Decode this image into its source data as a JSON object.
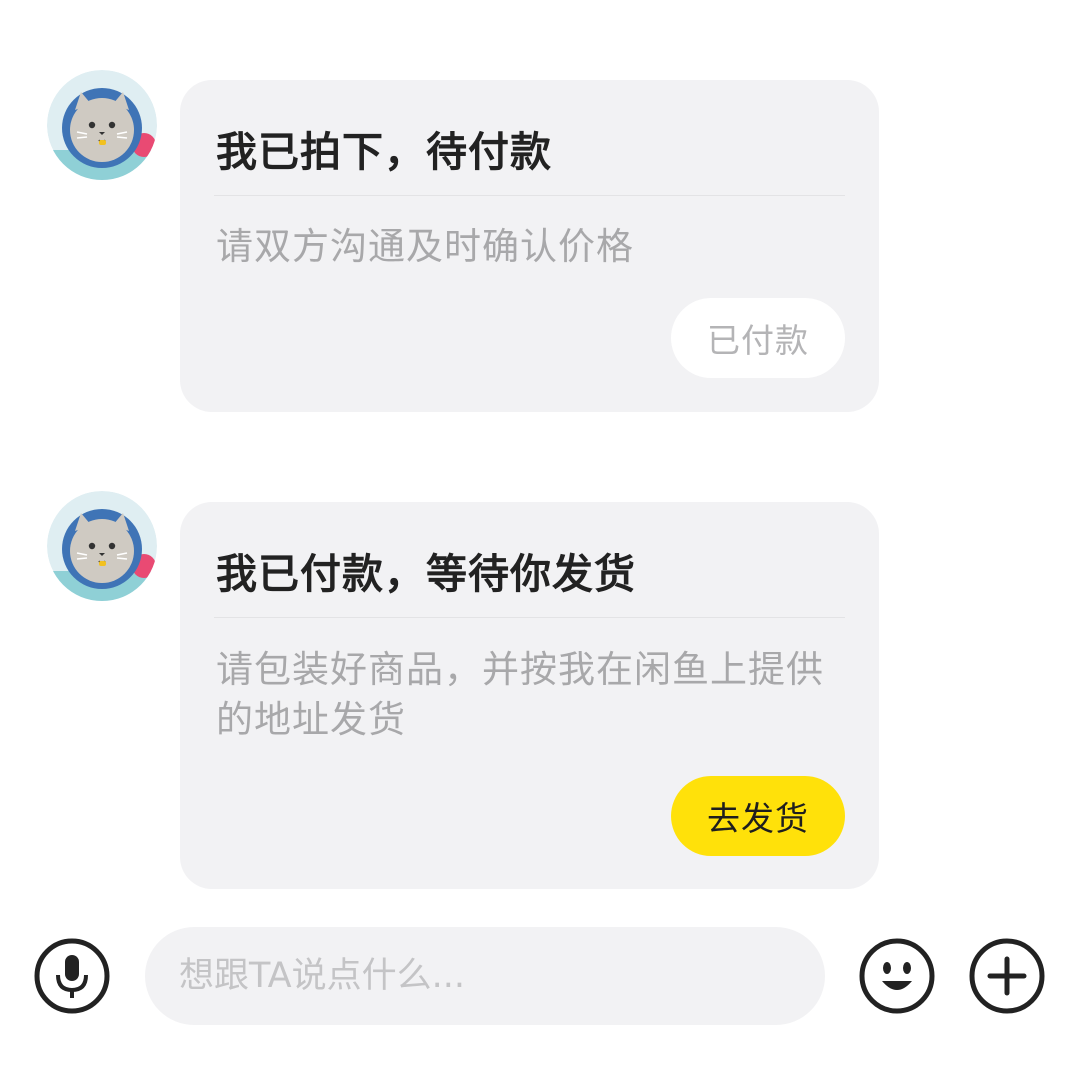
{
  "messages": [
    {
      "title": "我已拍下，待付款",
      "description": "请双方沟通及时确认价格",
      "button_label": "已付款",
      "button_state": "disabled"
    },
    {
      "title": "我已付款，等待你发货",
      "description": "请包装好商品，并按我在闲鱼上提供的地址发货",
      "button_label": "去发货",
      "button_state": "primary"
    }
  ],
  "input_bar": {
    "placeholder": "想跟TA说点什么...",
    "voice_icon": "microphone-icon",
    "emoji_icon": "emoji-icon",
    "more_icon": "plus-icon"
  },
  "colors": {
    "accent": "#ffe10a",
    "card_bg": "#f2f2f4",
    "title_text": "#222222",
    "desc_text": "#a8a8aa"
  }
}
